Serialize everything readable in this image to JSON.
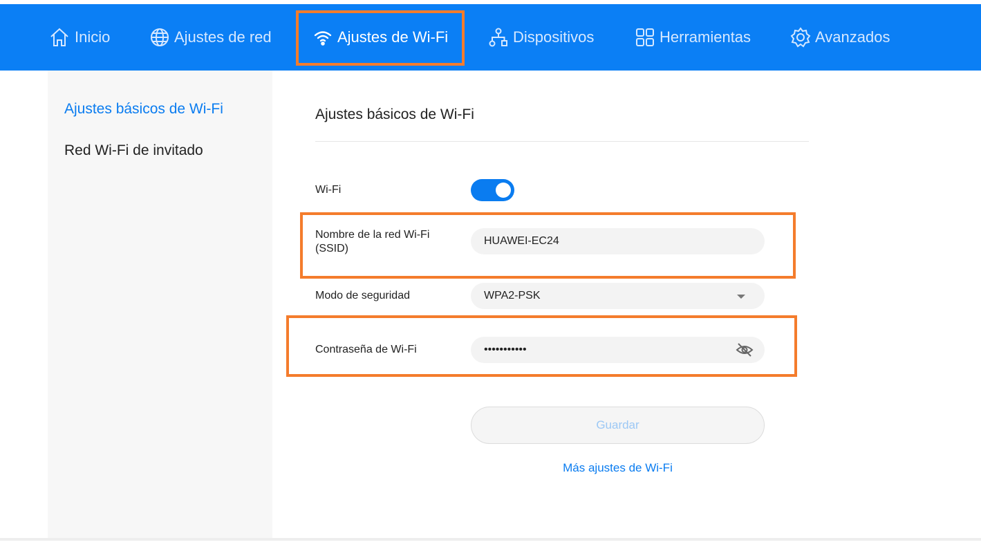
{
  "nav": {
    "items": [
      {
        "label": "Inicio",
        "icon": "home-icon"
      },
      {
        "label": "Ajustes de red",
        "icon": "globe-icon"
      },
      {
        "label": "Ajustes de Wi-Fi",
        "icon": "wifi-icon",
        "active": true
      },
      {
        "label": "Dispositivos",
        "icon": "devices-icon"
      },
      {
        "label": "Herramientas",
        "icon": "tools-grid-icon"
      },
      {
        "label": "Avanzados",
        "icon": "gear-icon"
      }
    ]
  },
  "sidebar": {
    "items": [
      {
        "label": "Ajustes básicos de Wi-Fi",
        "active": true
      },
      {
        "label": "Red Wi-Fi de invitado"
      }
    ]
  },
  "main": {
    "title": "Ajustes básicos de Wi-Fi",
    "wifi": {
      "label": "Wi-Fi",
      "enabled": true
    },
    "ssid": {
      "label_line1": "Nombre de la red Wi-Fi",
      "label_line2": "(SSID)",
      "value": "HUAWEI-EC24"
    },
    "security": {
      "label": "Modo de seguridad",
      "value": "WPA2-PSK"
    },
    "password": {
      "label": "Contraseña de Wi-Fi",
      "value": "•••••••••••"
    },
    "save_label": "Guardar",
    "more_link": "Más ajustes de Wi-Fi"
  },
  "colors": {
    "accent": "#0b7ff5",
    "highlight": "#f47c2c"
  }
}
